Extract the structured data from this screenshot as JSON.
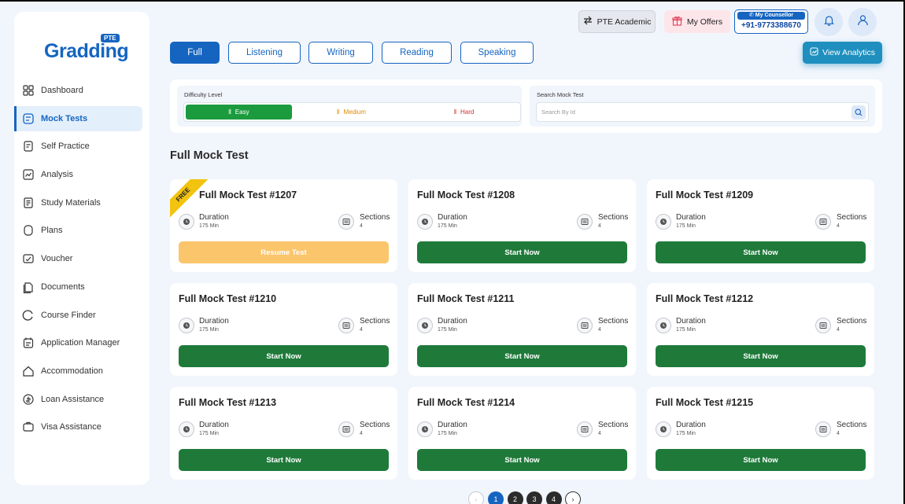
{
  "brand": {
    "name": "Gradding",
    "badge": "PTE"
  },
  "sidebar": {
    "items": [
      {
        "label": "Dashboard",
        "icon": "grid-icon",
        "active": false
      },
      {
        "label": "Mock Tests",
        "icon": "mock-test-icon",
        "active": true
      },
      {
        "label": "Self Practice",
        "icon": "practice-icon",
        "active": false
      },
      {
        "label": "Analysis",
        "icon": "analysis-icon",
        "active": false
      },
      {
        "label": "Study Materials",
        "icon": "book-icon",
        "active": false
      },
      {
        "label": "Plans",
        "icon": "plans-icon",
        "active": false
      },
      {
        "label": "Voucher",
        "icon": "voucher-icon",
        "active": false
      },
      {
        "label": "Documents",
        "icon": "documents-icon",
        "active": false
      },
      {
        "label": "Course Finder",
        "icon": "course-finder-icon",
        "active": false
      },
      {
        "label": "Application Manager",
        "icon": "application-icon",
        "active": false
      },
      {
        "label": "Accommodation",
        "icon": "home-icon",
        "active": false
      },
      {
        "label": "Loan Assistance",
        "icon": "loan-icon",
        "active": false
      },
      {
        "label": "Visa Assistance",
        "icon": "visa-icon",
        "active": false
      }
    ]
  },
  "topbar": {
    "exam": "PTE Academic",
    "offers": "My Offers",
    "counsellor_label": "My Counsellor",
    "counsellor_phone": "+91-9773388670",
    "analytics": "View Analytics"
  },
  "tabs": [
    {
      "label": "Full",
      "active": true
    },
    {
      "label": "Listening",
      "active": false
    },
    {
      "label": "Writing",
      "active": false
    },
    {
      "label": "Reading",
      "active": false
    },
    {
      "label": "Speaking",
      "active": false
    }
  ],
  "filters": {
    "difficulty_label": "Difficulty Level",
    "options": [
      {
        "label": "Easy",
        "color": "#ffffff",
        "active": true
      },
      {
        "label": "Medium",
        "color": "#e08a00",
        "active": false
      },
      {
        "label": "Hard",
        "color": "#d32f2f",
        "active": false
      }
    ],
    "search_label": "Search Mock Test",
    "search_placeholder": "Search By Id"
  },
  "section_title": "Full Mock Test",
  "cards": [
    {
      "title": "Full Mock Test #1207",
      "duration_label": "Duration",
      "duration": "175 Min",
      "sections_label": "Sections",
      "sections": "4",
      "button": "Resume Test",
      "state": "resume",
      "ribbon": "FREE"
    },
    {
      "title": "Full Mock Test #1208",
      "duration_label": "Duration",
      "duration": "175 Min",
      "sections_label": "Sections",
      "sections": "4",
      "button": "Start Now",
      "state": "start"
    },
    {
      "title": "Full Mock Test #1209",
      "duration_label": "Duration",
      "duration": "175 Min",
      "sections_label": "Sections",
      "sections": "4",
      "button": "Start Now",
      "state": "start"
    },
    {
      "title": "Full Mock Test #1210",
      "duration_label": "Duration",
      "duration": "175 Min",
      "sections_label": "Sections",
      "sections": "4",
      "button": "Start Now",
      "state": "start"
    },
    {
      "title": "Full Mock Test #1211",
      "duration_label": "Duration",
      "duration": "175 Min",
      "sections_label": "Sections",
      "sections": "4",
      "button": "Start Now",
      "state": "start"
    },
    {
      "title": "Full Mock Test #1212",
      "duration_label": "Duration",
      "duration": "175 Min",
      "sections_label": "Sections",
      "sections": "4",
      "button": "Start Now",
      "state": "start"
    },
    {
      "title": "Full Mock Test #1213",
      "duration_label": "Duration",
      "duration": "175 Min",
      "sections_label": "Sections",
      "sections": "4",
      "button": "Start Now",
      "state": "start"
    },
    {
      "title": "Full Mock Test #1214",
      "duration_label": "Duration",
      "duration": "175 Min",
      "sections_label": "Sections",
      "sections": "4",
      "button": "Start Now",
      "state": "start"
    },
    {
      "title": "Full Mock Test #1215",
      "duration_label": "Duration",
      "duration": "175 Min",
      "sections_label": "Sections",
      "sections": "4",
      "button": "Start Now",
      "state": "start"
    }
  ],
  "pagination": {
    "prev": "‹",
    "pages": [
      "1",
      "2",
      "3",
      "4"
    ],
    "current": "1",
    "next": "›"
  },
  "colors": {
    "primary": "#1565c0",
    "success": "#1f7a3a",
    "resume": "#fbc56b",
    "ribbon": "#f2c30f",
    "accent": "#1e8fbe"
  }
}
